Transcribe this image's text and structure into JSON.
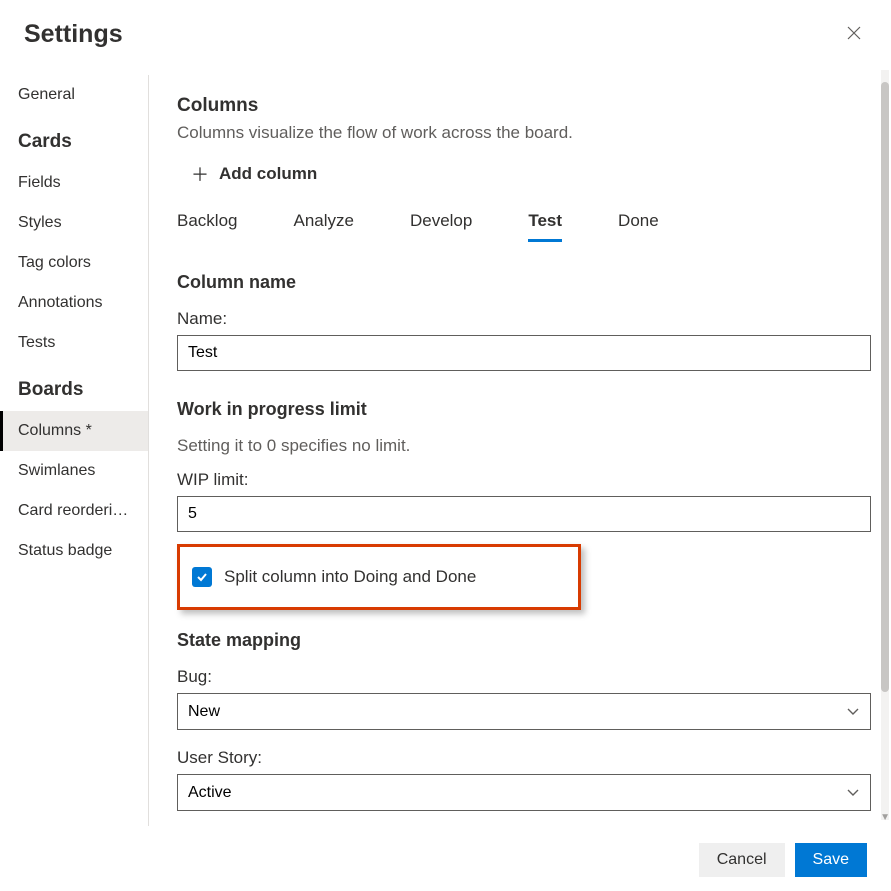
{
  "header": {
    "title": "Settings"
  },
  "sidebar": {
    "general": "General",
    "cards_title": "Cards",
    "cards_items": [
      "Fields",
      "Styles",
      "Tag colors",
      "Annotations",
      "Tests"
    ],
    "boards_title": "Boards",
    "boards_items": [
      "Columns *",
      "Swimlanes",
      "Card reorderi…",
      "Status badge"
    ]
  },
  "main": {
    "title": "Columns",
    "desc": "Columns visualize the flow of work across the board.",
    "add_column": "Add column",
    "tabs": [
      "Backlog",
      "Analyze",
      "Develop",
      "Test",
      "Done"
    ],
    "active_tab": "Test",
    "column_name_section": "Column name",
    "name_label": "Name:",
    "name_value": "Test",
    "wip_section": "Work in progress limit",
    "wip_help": "Setting it to 0 specifies no limit.",
    "wip_label": "WIP limit:",
    "wip_value": "5",
    "split_label": "Split column into Doing and Done",
    "state_section": "State mapping",
    "bug_label": "Bug:",
    "bug_value": "New",
    "story_label": "User Story:",
    "story_value": "Active"
  },
  "footer": {
    "cancel": "Cancel",
    "save": "Save"
  }
}
